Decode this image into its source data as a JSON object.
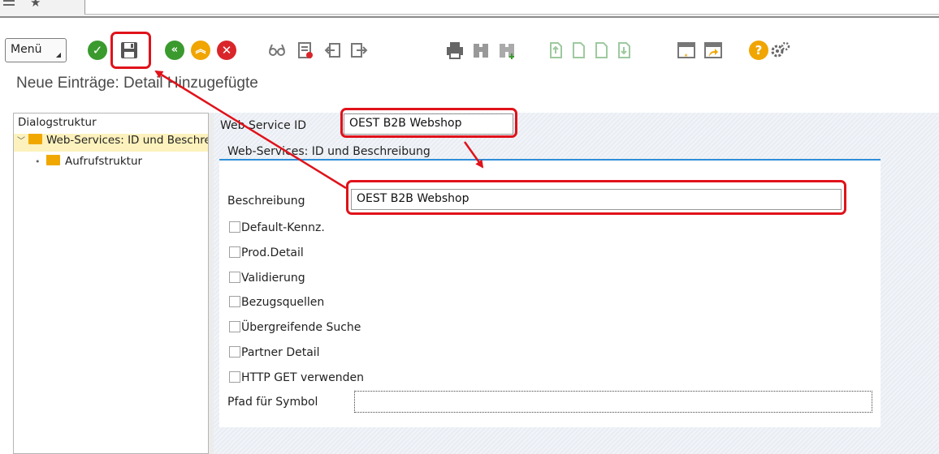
{
  "toolbar": {
    "menu_label": "Menü",
    "icons": [
      "check-icon",
      "save-icon",
      "back-icon",
      "exit-icon",
      "cancel-icon",
      "glasses-icon",
      "delete-icon",
      "prev-icon",
      "next-icon",
      "print-icon",
      "find-icon",
      "find-next-icon",
      "first-page-icon",
      "prev-page-icon",
      "next-page-icon",
      "last-page-icon",
      "new-session-icon",
      "shortcut-icon",
      "help-icon",
      "settings-icon"
    ]
  },
  "page": {
    "title": "Neue Einträge: Detail Hinzugefügte"
  },
  "tree": {
    "header": "Dialogstruktur",
    "items": [
      {
        "label": "Web-Services: ID und Beschreibung",
        "selected": true
      },
      {
        "label": "Aufrufstruktur",
        "selected": false
      }
    ]
  },
  "form": {
    "service_id_label": "Web Service ID",
    "service_id_value": "OEST B2B Webshop",
    "group_title": "Web-Services: ID und Beschreibung",
    "description_label": "Beschreibung",
    "description_value": "OEST B2B Webshop",
    "checkboxes": [
      {
        "label": "Default-Kennz.",
        "checked": false
      },
      {
        "label": "Prod.Detail",
        "checked": false
      },
      {
        "label": "Validierung",
        "checked": false
      },
      {
        "label": "Bezugsquellen",
        "checked": false
      },
      {
        "label": "Übergreifende Suche",
        "checked": false
      },
      {
        "label": "Partner Detail",
        "checked": false
      },
      {
        "label": "HTTP GET verwenden",
        "checked": false
      }
    ],
    "symbol_path_label": "Pfad für Symbol",
    "symbol_path_value": ""
  },
  "colors": {
    "highlight": "#e0121a",
    "accent_blue": "#2f8ed8",
    "selected_row": "#fdf2bd"
  }
}
